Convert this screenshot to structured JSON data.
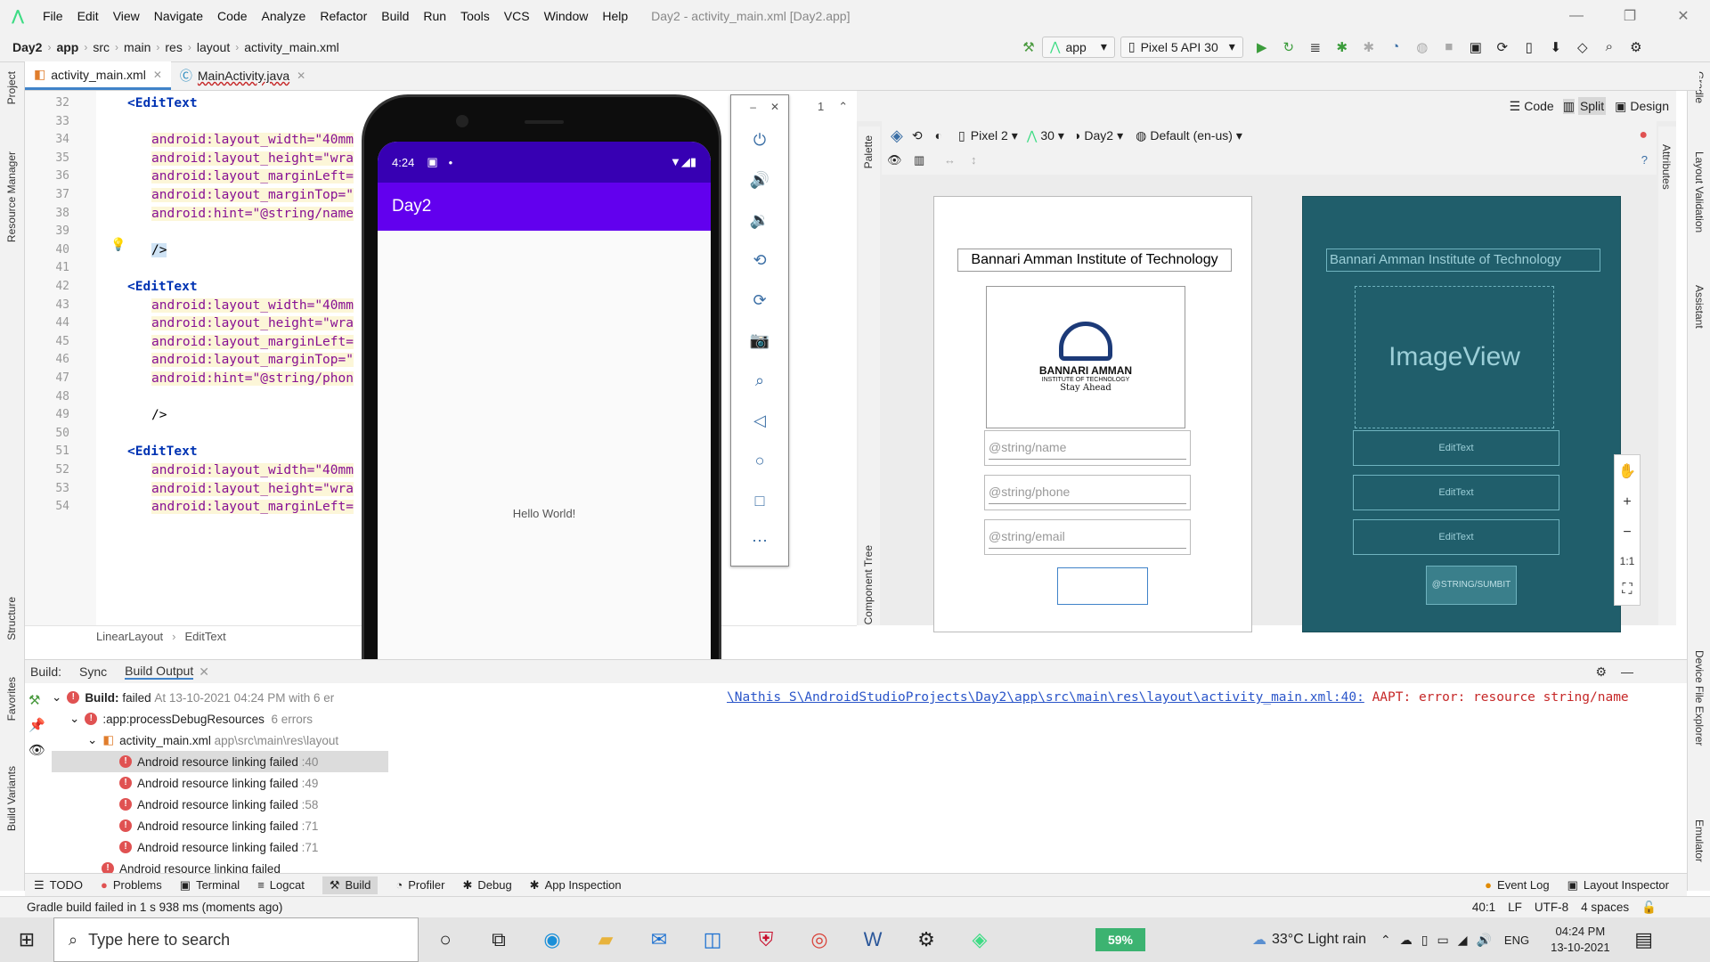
{
  "menu": {
    "items": [
      "File",
      "Edit",
      "View",
      "Navigate",
      "Code",
      "Analyze",
      "Refactor",
      "Build",
      "Run",
      "Tools",
      "VCS",
      "Window",
      "Help"
    ],
    "title": "Day2 - activity_main.xml [Day2.app]"
  },
  "nav": {
    "breadcrumbs": [
      "Day2",
      "app",
      "src",
      "main",
      "res",
      "layout",
      "activity_main.xml"
    ],
    "run_config": "app",
    "device": "Pixel 5 API 30"
  },
  "tabs": [
    {
      "label": "activity_main.xml"
    },
    {
      "label": "MainActivity.java"
    }
  ],
  "left_strip": [
    "Project",
    "Resource Manager",
    "Structure",
    "Favorites",
    "Build Variants"
  ],
  "right_strip": [
    "Gradle",
    "Layout Validation",
    "Assistant",
    "Device File Explorer",
    "Emulator"
  ],
  "editor": {
    "lines": [
      {
        "n": "32",
        "text": "<EditText"
      },
      {
        "n": "33",
        "text": ""
      },
      {
        "n": "34",
        "text": "android:layout_width=\"40mm"
      },
      {
        "n": "35",
        "text": "android:layout_height=\"wra"
      },
      {
        "n": "36",
        "text": "android:layout_marginLeft="
      },
      {
        "n": "37",
        "text": "android:layout_marginTop=\""
      },
      {
        "n": "38",
        "text": "android:hint=\"@string/name"
      },
      {
        "n": "39",
        "text": ""
      },
      {
        "n": "40",
        "text": "/>"
      },
      {
        "n": "41",
        "text": ""
      },
      {
        "n": "42",
        "text": "<EditText"
      },
      {
        "n": "43",
        "text": "android:layout_width=\"40mm"
      },
      {
        "n": "44",
        "text": "android:layout_height=\"wra"
      },
      {
        "n": "45",
        "text": "android:layout_marginLeft="
      },
      {
        "n": "46",
        "text": "android:layout_marginTop=\""
      },
      {
        "n": "47",
        "text": "android:hint=\"@string/phon"
      },
      {
        "n": "48",
        "text": ""
      },
      {
        "n": "49",
        "text": "/>"
      },
      {
        "n": "50",
        "text": ""
      },
      {
        "n": "51",
        "text": "<EditText"
      },
      {
        "n": "52",
        "text": "android:layout_width=\"40mm"
      },
      {
        "n": "53",
        "text": "android:layout_height=\"wra"
      },
      {
        "n": "54",
        "text": "android:layout_marginLeft="
      }
    ],
    "breadcrumb": [
      "LinearLayout",
      "EditText"
    ],
    "find_count": "1"
  },
  "emulator": {
    "time": "4:24",
    "app_title": "Day2",
    "hello": "Hello World!"
  },
  "design": {
    "modes": [
      "Code",
      "Split",
      "Design"
    ],
    "device": "Pixel 2",
    "api": "30",
    "theme": "Day2",
    "locale": "Default (en-us)",
    "palette_label": "Palette",
    "tree_label": "Component Tree",
    "attributes_label": "Attributes",
    "blueprint_title": "Bannari Amman Institute of Technology",
    "logo_line1": "BANNARI AMMAN",
    "logo_line2": "INSTITUTE OF TECHNOLOGY",
    "logo_line3": "Stay Ahead",
    "hint_name": "@string/name",
    "hint_phone": "@string/phone",
    "hint_email": "@string/email",
    "image_view": "ImageView",
    "edit_text": "EditText",
    "submit": "@STRING/SUMBIT",
    "zoom_fit": "1:1"
  },
  "build": {
    "tabs": [
      "Build:",
      "Sync",
      "Build Output"
    ],
    "root_label": "Build:",
    "root_status": "failed",
    "root_time": "At 13-10-2021 04:24 PM with 6 er",
    "task": ":app:processDebugResources",
    "task_count": "6 errors",
    "file": "activity_main.xml",
    "file_path": "app\\src\\main\\res\\layout",
    "errors": [
      {
        "msg": "Android resource linking failed",
        "line": ":40"
      },
      {
        "msg": "Android resource linking failed",
        "line": ":49"
      },
      {
        "msg": "Android resource linking failed",
        "line": ":58"
      },
      {
        "msg": "Android resource linking failed",
        "line": ":71"
      },
      {
        "msg": "Android resource linking failed",
        "line": ":71"
      },
      {
        "msg": "Android resource linking failed",
        "line": ""
      }
    ],
    "output_link": "\\Nathis S\\AndroidStudioProjects\\Day2\\app\\src\\main\\res\\layout\\activity_main.xml:40:",
    "output_error": "AAPT: error: resource string/name"
  },
  "toolwindows": [
    "TODO",
    "Problems",
    "Terminal",
    "Logcat",
    "Build",
    "Profiler",
    "Debug",
    "App Inspection"
  ],
  "toolwindows_right": [
    "Event Log",
    "Layout Inspector"
  ],
  "status": {
    "message": "Gradle build failed in 1 s 938 ms (moments ago)",
    "position": "40:1",
    "line_sep": "LF",
    "encoding": "UTF-8",
    "indent": "4 spaces"
  },
  "taskbar": {
    "search_placeholder": "Type here to search",
    "battery": "59%",
    "weather": "33°C  Light rain",
    "lang": "ENG",
    "time": "04:24 PM",
    "date": "13-10-2021"
  }
}
